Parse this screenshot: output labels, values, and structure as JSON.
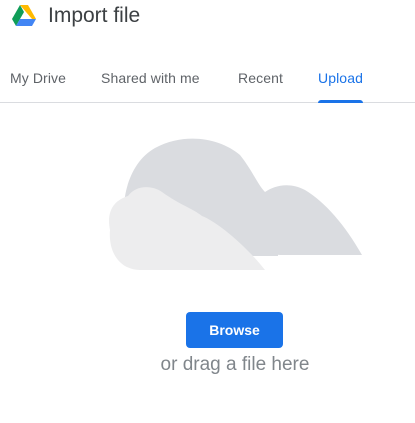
{
  "header": {
    "title": "Import file",
    "logo": "google-drive-logo-icon"
  },
  "tabs": [
    {
      "label": "My Drive",
      "active": false
    },
    {
      "label": "Shared with me",
      "active": false
    },
    {
      "label": "Recent",
      "active": false
    },
    {
      "label": "Upload",
      "active": true
    }
  ],
  "upload": {
    "illustration": "cloud-illustration-icon",
    "browse_label": "Browse",
    "drag_text": "or drag a file here"
  },
  "colors": {
    "accent": "#1a73e8",
    "tab_inactive": "#5f6368",
    "muted_text": "#80868b",
    "cloud_back": "#dadce0",
    "cloud_front": "#ededee"
  }
}
